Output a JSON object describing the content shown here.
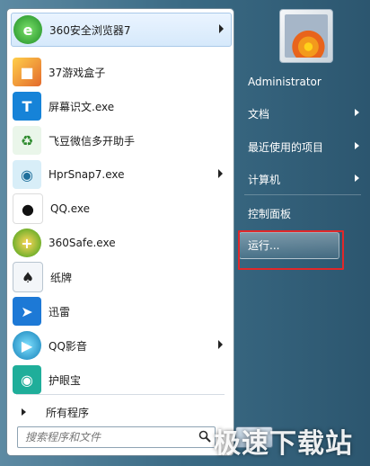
{
  "left_menu": {
    "items": [
      {
        "label": "360安全浏览器7",
        "icon": "ie-e-icon",
        "arrow": true,
        "color": "#3aa63a"
      },
      {
        "label": "37游戏盒子",
        "icon": "cube-game-icon",
        "arrow": false,
        "color": "#f2a12a"
      },
      {
        "label": "屏幕识文.exe",
        "icon": "t-letter-icon",
        "arrow": false,
        "color": "#1683d8"
      },
      {
        "label": "飞豆微信多开助手",
        "icon": "recycle-icon",
        "arrow": false,
        "color": "#3c9c3c"
      },
      {
        "label": "HprSnap7.exe",
        "icon": "camera-icon",
        "arrow": true,
        "color": "#2f8cc9"
      },
      {
        "label": "QQ.exe",
        "icon": "penguin-icon",
        "arrow": false,
        "color": "#222222"
      },
      {
        "label": "360Safe.exe",
        "icon": "plus-shield-icon",
        "arrow": false,
        "color": "#4fae1e"
      },
      {
        "label": "纸牌",
        "icon": "cards-icon",
        "arrow": false,
        "color": "#8aa3b8"
      },
      {
        "label": "迅雷",
        "icon": "bird-icon",
        "arrow": false,
        "color": "#1d79d6"
      },
      {
        "label": "QQ影音",
        "icon": "film-icon",
        "arrow": true,
        "color": "#1aa7d8"
      },
      {
        "label": "护眼宝",
        "icon": "eye-icon",
        "arrow": false,
        "color": "#1fae9a"
      }
    ],
    "all_programs": "所有程序",
    "search_placeholder": "搜索程序和文件"
  },
  "right_menu": {
    "user": "Administrator",
    "items": [
      {
        "label": "文档",
        "arrow": true
      },
      {
        "label": "最近使用的项目",
        "arrow": true
      },
      {
        "label": "计算机",
        "arrow": true
      },
      {
        "label": "控制面板",
        "arrow": false
      },
      {
        "label": "运行...",
        "arrow": false
      }
    ]
  },
  "watermark": "极速下载站",
  "colors": {
    "highlight_box": "#e0282a",
    "panel_blue": "#2f5a74"
  }
}
